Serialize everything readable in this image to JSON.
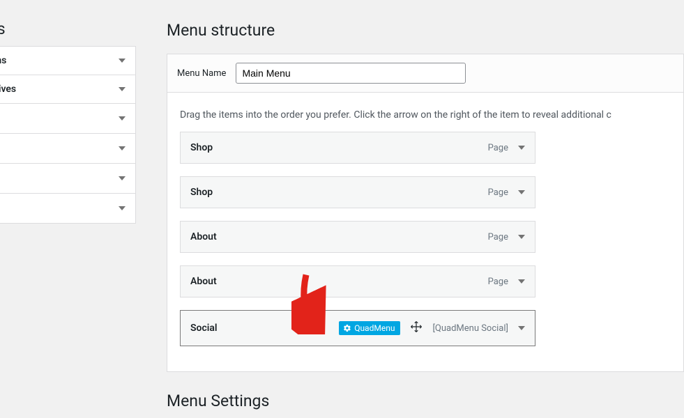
{
  "sidebar": {
    "title_fragment": "ns",
    "boxes": [
      {
        "label": "ms"
      },
      {
        "label": "hives"
      },
      {
        "label": ""
      },
      {
        "label": ""
      },
      {
        "label": ""
      },
      {
        "label": ""
      }
    ]
  },
  "main": {
    "heading": "Menu structure",
    "menu_name_label": "Menu Name",
    "menu_name_value": "Main Menu",
    "instructions": "Drag the items into the order you prefer. Click the arrow on the right of the item to reveal additional c",
    "items": [
      {
        "title": "Shop",
        "type": "Page",
        "quadmenu": false,
        "active": false
      },
      {
        "title": "Shop",
        "type": "Page",
        "quadmenu": false,
        "active": false
      },
      {
        "title": "About",
        "type": "Page",
        "quadmenu": false,
        "active": false
      },
      {
        "title": "About",
        "type": "Page",
        "quadmenu": false,
        "active": false
      },
      {
        "title": "Social",
        "type": "[QuadMenu Social]",
        "quadmenu": true,
        "quadmenu_label": "QuadMenu",
        "active": true
      }
    ],
    "settings_heading": "Menu Settings"
  }
}
